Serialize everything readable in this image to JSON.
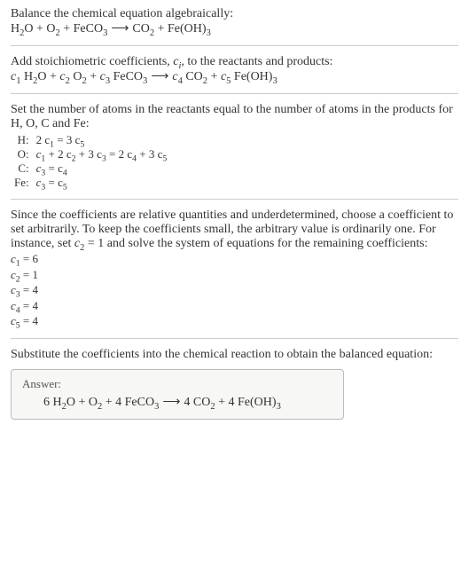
{
  "header": {
    "line1": "Balance the chemical equation algebraically:"
  },
  "eq_unbalanced": {
    "t1": "H",
    "t1s": "2",
    "t2": "O + O",
    "t2s": "2",
    "t3": " + FeCO",
    "t3s": "3",
    "arrow": " ⟶ ",
    "t4": "CO",
    "t4s": "2",
    "t5": " + Fe(OH)",
    "t5s": "3"
  },
  "stoich": {
    "intro1": "Add stoichiometric coefficients, ",
    "ci": "c",
    "ci_sub": "i",
    "intro2": ", to the reactants and products:"
  },
  "eq_coeffs": {
    "c1": "c",
    "c1s": "1",
    "sp1": " H",
    "sp1s": "2",
    "sp1b": "O + ",
    "c2": "c",
    "c2s": "2",
    "sp2": " O",
    "sp2s": "2",
    "sp2b": " + ",
    "c3": "c",
    "c3s": "3",
    "sp3": " FeCO",
    "sp3s": "3",
    "arrow": " ⟶ ",
    "c4": "c",
    "c4s": "4",
    "sp4": " CO",
    "sp4s": "2",
    "sp4b": " + ",
    "c5": "c",
    "c5s": "5",
    "sp5": " Fe(OH)",
    "sp5s": "3"
  },
  "atoms_intro": "Set the number of atoms in the reactants equal to the number of atoms in the products for H, O, C and Fe:",
  "atoms": [
    {
      "el": "H:",
      "lhs_a": "2 c",
      "lhs_as": "1",
      "mid": " = 3 c",
      "rhs_s": "5"
    },
    {
      "el": "O:",
      "expr_parts": [
        "c",
        "1",
        " + 2 c",
        "2",
        " + 3 c",
        "3",
        " = 2 c",
        "4",
        " + 3 c",
        "5"
      ]
    },
    {
      "el": "C:",
      "lhs_a": "c",
      "lhs_as": "3",
      "mid": " = c",
      "rhs_s": "4"
    },
    {
      "el": "Fe:",
      "lhs_a": "c",
      "lhs_as": "3",
      "mid": " = c",
      "rhs_s": "5"
    }
  ],
  "choose": {
    "p1": "Since the coefficients are relative quantities and underdetermined, choose a coefficient to set arbitrarily. To keep the coefficients small, the arbitrary value is ordinarily one. For instance, set ",
    "cv": "c",
    "cvs": "2",
    "p2": " = 1 and solve the system of equations for the remaining coefficients:"
  },
  "solved": [
    {
      "c": "c",
      "s": "1",
      "eq": " = 6"
    },
    {
      "c": "c",
      "s": "2",
      "eq": " = 1"
    },
    {
      "c": "c",
      "s": "3",
      "eq": " = 4"
    },
    {
      "c": "c",
      "s": "4",
      "eq": " = 4"
    },
    {
      "c": "c",
      "s": "5",
      "eq": " = 4"
    }
  ],
  "subst": "Substitute the coefficients into the chemical reaction to obtain the balanced equation:",
  "answer": {
    "label": "Answer:",
    "t1": "6 H",
    "t1s": "2",
    "t2": "O + O",
    "t2s": "2",
    "t3": " + 4 FeCO",
    "t3s": "3",
    "arrow": " ⟶ ",
    "t4": "4 CO",
    "t4s": "2",
    "t5": " + 4 Fe(OH)",
    "t5s": "3"
  }
}
